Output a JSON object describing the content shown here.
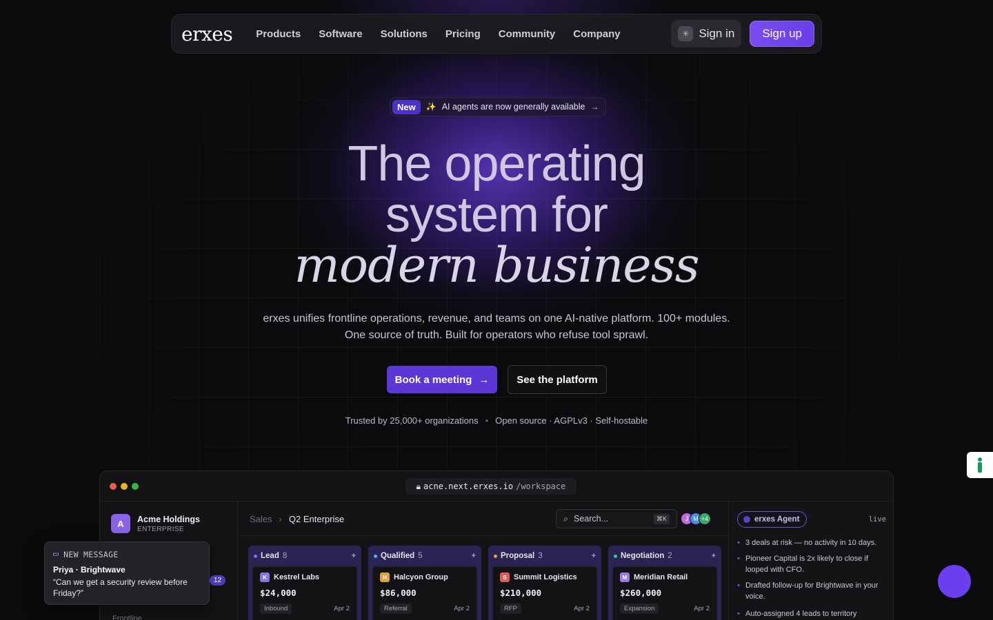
{
  "nav": {
    "logo": "erxes",
    "links": [
      "Products",
      "Software",
      "Solutions",
      "Pricing",
      "Community",
      "Company"
    ],
    "sign_in": "Sign in",
    "sign_up": "Sign up"
  },
  "announcement": {
    "tag": "New",
    "text": "AI agents are now generally available"
  },
  "hero": {
    "line1": "The operating",
    "line2": "system for",
    "line3": "modern business",
    "subtitle": "erxes unifies frontline operations, revenue, and teams on one AI-native platform. 100+ modules. One source of truth. Built for operators who refuse tool sprawl.",
    "cta_primary": "Book a meeting",
    "cta_secondary": "See the platform",
    "trust_left": "Trusted by 25,000+ organizations",
    "trust_right": "Open source · AGPLv3 · Self-hostable"
  },
  "app": {
    "url_host": "acne.next.erxes.io",
    "url_path": "/workspace",
    "org_initial": "A",
    "org_name": "Acme Holdings",
    "org_plan": "ENTERPRISE",
    "sidebar_partial": "Frontline",
    "breadcrumb_root": "Sales",
    "breadcrumb_current": "Q2 Enterprise",
    "search_placeholder": "Search...",
    "search_shortcut": "⌘K",
    "avatars": [
      "J",
      "M",
      "+4"
    ],
    "columns": [
      {
        "name": "Lead",
        "count": "8",
        "color": "#7b6cf0",
        "card": {
          "initial": "K",
          "company": "Kestrel Labs",
          "amount": "$24,000",
          "tag": "Inbound",
          "date": "Apr 2",
          "logo_color": "#8a73e8"
        }
      },
      {
        "name": "Qualified",
        "count": "5",
        "color": "#5aa8ff",
        "card": {
          "initial": "H",
          "company": "Halcyon Group",
          "amount": "$86,000",
          "tag": "Referral",
          "date": "Apr 2",
          "logo_color": "#e0a03a"
        }
      },
      {
        "name": "Proposal",
        "count": "3",
        "color": "#f0a040",
        "card": {
          "initial": "S",
          "company": "Summit Logistics",
          "amount": "$210,000",
          "tag": "RFP",
          "date": "Apr 2",
          "logo_color": "#e05a5a"
        }
      },
      {
        "name": "Negotiation",
        "count": "2",
        "color": "#36c7a0",
        "card": {
          "initial": "M",
          "company": "Meridian Retail",
          "amount": "$260,000",
          "tag": "Expansion",
          "date": "Apr 2",
          "logo_color": "#9a7ae8"
        }
      }
    ],
    "agent_label": "erxes Agent",
    "agent_status": "live",
    "insights": [
      "3 deals at risk — no activity in 10 days.",
      "Pioneer Capital is 2x likely to close if looped with CFO.",
      "Drafted follow-up for Brightwave in your voice.",
      "Auto-assigned 4 leads to territory"
    ]
  },
  "toast": {
    "header": "NEW MESSAGE",
    "sender": "Priya · Brightwave",
    "message": "“Can we get a security review before Friday?”",
    "unread_count": "12"
  },
  "colors": {
    "accent": "#6a3ff0",
    "background": "#0b0b0d"
  }
}
